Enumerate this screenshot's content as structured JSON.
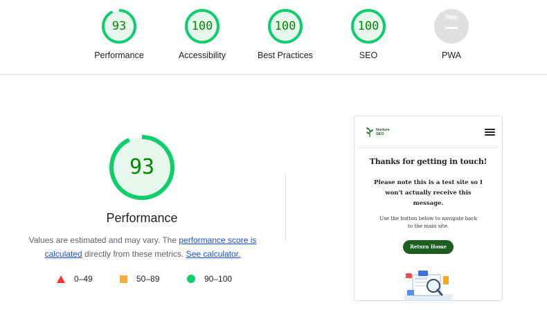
{
  "scores": [
    {
      "label": "Performance",
      "value": "93",
      "fraction": 0.93
    },
    {
      "label": "Accessibility",
      "value": "100",
      "fraction": 1.0
    },
    {
      "label": "Best Practices",
      "value": "100",
      "fraction": 1.0
    },
    {
      "label": "SEO",
      "value": "100",
      "fraction": 1.0
    }
  ],
  "pwa": {
    "label": "PWA",
    "badge_text": "PWA"
  },
  "main": {
    "score": "93",
    "fraction": 0.93,
    "title": "Performance",
    "desc_part1": "Values are estimated and may vary. The ",
    "link_score": "performance score is calculated",
    "desc_part2": " directly from these metrics. ",
    "link_calculator": "See calculator."
  },
  "legend": [
    {
      "shape": "triangle",
      "color": "#ff3333",
      "range": "0–49"
    },
    {
      "shape": "square",
      "color": "#ffaa33",
      "range": "50–89"
    },
    {
      "shape": "circle",
      "color": "#0cce6b",
      "range": "90–100"
    }
  ],
  "preview": {
    "logo_line1": "Nurture",
    "logo_line2": "SEO",
    "heading": "Thanks for getting in touch!",
    "note": "Please note this is a test site so I won't actually receive this message.",
    "sub": "Use the button below to navigate back to the main site.",
    "button": "Return Home"
  },
  "colors": {
    "pass_green": "#0cce6b",
    "pass_text": "#008a00",
    "pass_fill": "#e8f7ee",
    "link": "#1a4fd6"
  }
}
